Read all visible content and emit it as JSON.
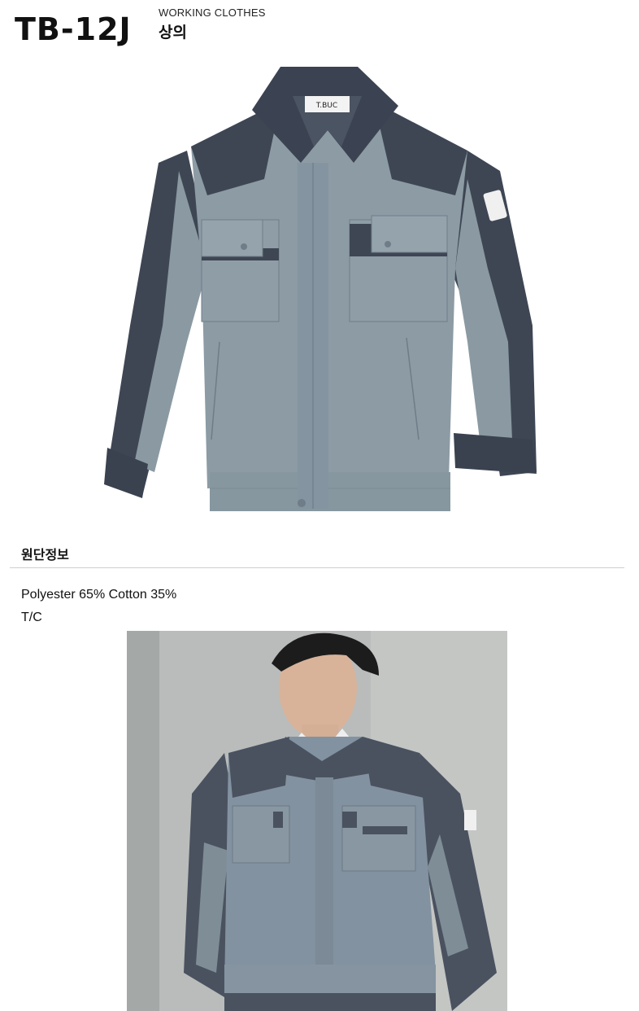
{
  "header": {
    "model_code": "TB-12J",
    "category_en": "WORKING CLOTHES",
    "category_ko": "상의"
  },
  "product_image": {
    "label_tag": "T.BUC"
  },
  "fabric_info": {
    "title": "원단정보",
    "composition": "Polyester 65% Cotton 35%",
    "type": "T/C"
  },
  "colors": {
    "body_gray": "#8c9ba4",
    "panel_navy": "#3e4654",
    "background": "#ffffff"
  }
}
